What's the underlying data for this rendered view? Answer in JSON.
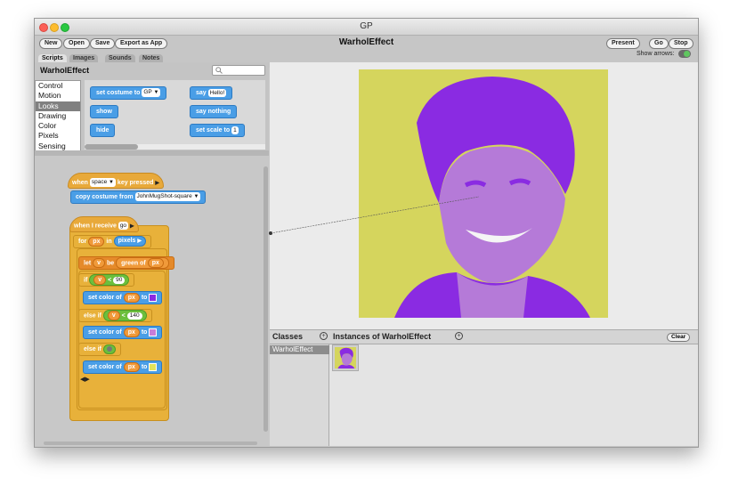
{
  "window": {
    "title": "GP",
    "class_name": "WarholEffect"
  },
  "toolbar": {
    "left_buttons": [
      "New",
      "Open",
      "Save",
      "Export as App"
    ],
    "right_buttons": [
      "Present",
      "Go",
      "Stop"
    ],
    "show_arrows_label": "Show arrows:",
    "show_arrows_on": true
  },
  "tabs": [
    "Scripts",
    "Images",
    "Sounds",
    "Notes"
  ],
  "palette": {
    "title": "WarholEffect",
    "categories": [
      "Control",
      "Motion",
      "Looks",
      "Drawing",
      "Color",
      "Pixels",
      "Sensing"
    ],
    "selected_category": "Looks",
    "blocks": {
      "set_costume": "set costume to",
      "set_costume_arg": "GP",
      "say": "say",
      "say_arg": "Hello!",
      "show": "show",
      "say_nothing": "say nothing",
      "hide": "hide",
      "set_scale": "set scale to",
      "set_scale_arg": "1"
    }
  },
  "script1": {
    "when": "when",
    "key": "space",
    "key_pressed": "key pressed",
    "copy_costume": "copy costume from",
    "copy_arg": "JohnMugShot-square"
  },
  "script2": {
    "when_receive": "when I receive",
    "msg": "go",
    "for": "for",
    "px": "px",
    "in": "in",
    "pixels": "pixels",
    "let": "let",
    "v": "v",
    "be": "be",
    "green_of": "green of",
    "if": "if",
    "lt": "<",
    "n90": "90",
    "set_color": "set color of",
    "to": "to",
    "else_if": "else if",
    "n140": "140",
    "colors": [
      "#8a2be2",
      "#c77dd8",
      "#e3e35a"
    ]
  },
  "bottom": {
    "classes_title": "Classes",
    "class_item": "WarholEffect",
    "instances_title": "Instances of WarholEffect",
    "clear": "Clear"
  },
  "stage_colors": {
    "background": "#d5d55d",
    "purple_dark": "#8a2be2",
    "purple_light": "#b57ad8"
  }
}
